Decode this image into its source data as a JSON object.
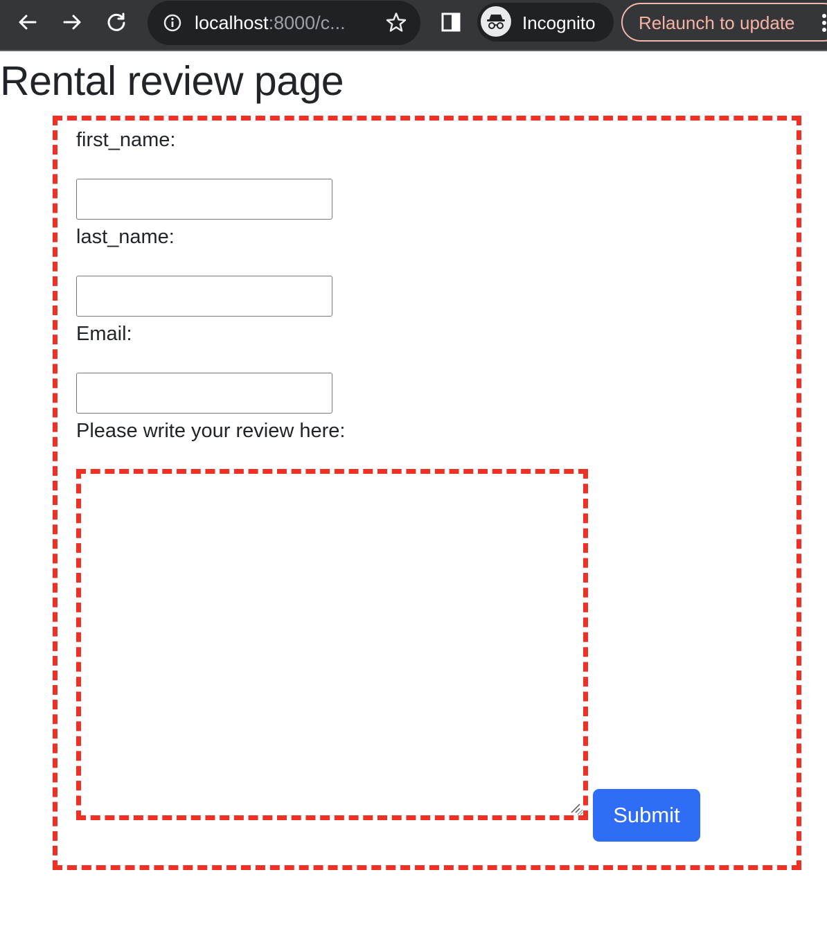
{
  "browser": {
    "url_host": "localhost",
    "url_rest": ":8000/c...",
    "incognito_label": "Incognito",
    "relaunch_label": "Relaunch to update",
    "icons": {
      "back": "arrow-left",
      "forward": "arrow-right",
      "reload": "reload",
      "site_info": "info-circle",
      "bookmark": "star",
      "side_panel": "side-panel",
      "incognito": "incognito-spy",
      "menu": "vertical-dots"
    }
  },
  "page": {
    "title": "Rental review page"
  },
  "form": {
    "first_name": {
      "label": "first_name:",
      "value": ""
    },
    "last_name": {
      "label": "last_name:",
      "value": ""
    },
    "email": {
      "label": "Email:",
      "value": ""
    },
    "review": {
      "label": "Please write your review here:",
      "value": ""
    },
    "submit_label": "Submit"
  },
  "colors": {
    "chrome_bg": "#35363a",
    "omnibox_bg": "#202124",
    "dashed_border": "#ee3124",
    "submit_bg": "#2f6df6",
    "relaunch_text": "#f6b3a2",
    "text": "#212529"
  }
}
